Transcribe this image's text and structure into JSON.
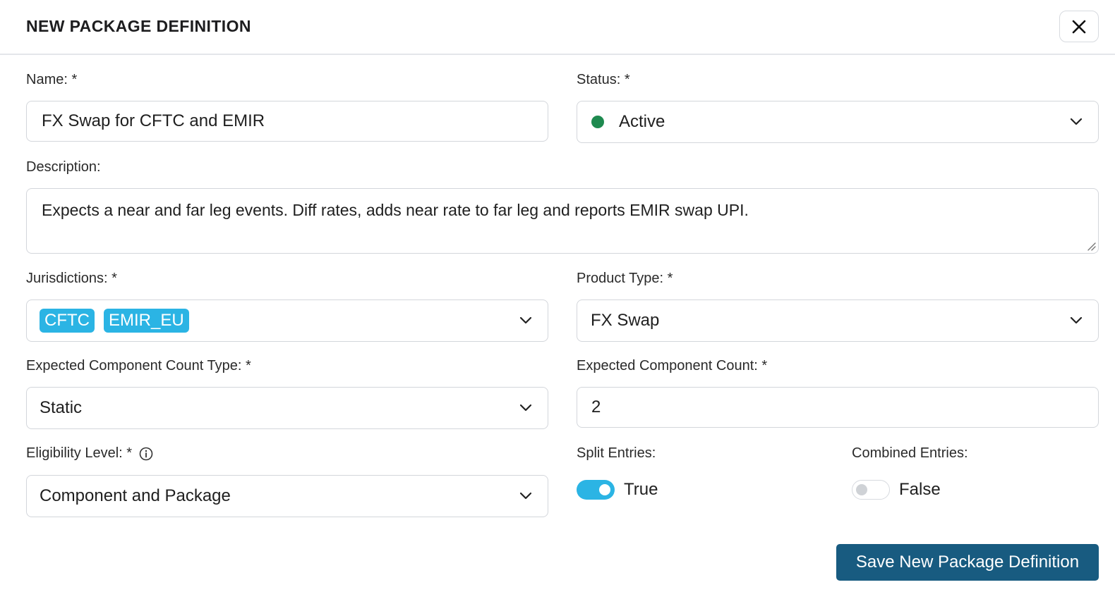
{
  "dialog": {
    "title": "NEW PACKAGE DEFINITION",
    "close_icon": "close-icon"
  },
  "form": {
    "name": {
      "label": "Name: *",
      "value": "FX Swap for CFTC and EMIR"
    },
    "status": {
      "label": "Status: *",
      "value": "Active",
      "dot_color": "#1e8a4f"
    },
    "description": {
      "label": "Description:",
      "value": "Expects a near and far leg events.  Diff rates, adds near rate to far leg and reports EMIR swap UPI."
    },
    "jurisdictions": {
      "label": "Jurisdictions: *",
      "chips": [
        "CFTC",
        "EMIR_EU"
      ],
      "chip_color": "#2bb4e4"
    },
    "product_type": {
      "label": "Product Type: *",
      "value": "FX Swap"
    },
    "count_type": {
      "label": "Expected Component Count Type: *",
      "value": "Static"
    },
    "count": {
      "label": "Expected Component Count: *",
      "value": "2"
    },
    "eligibility": {
      "label": "Eligibility Level: *",
      "value": "Component and Package",
      "info_icon": "info-icon"
    },
    "split_entries": {
      "label": "Split Entries:",
      "value": "True",
      "on": true
    },
    "combined_entries": {
      "label": "Combined Entries:",
      "value": "False",
      "on": false
    }
  },
  "actions": {
    "save_label": "Save New Package Definition",
    "save_color": "#185b80"
  }
}
